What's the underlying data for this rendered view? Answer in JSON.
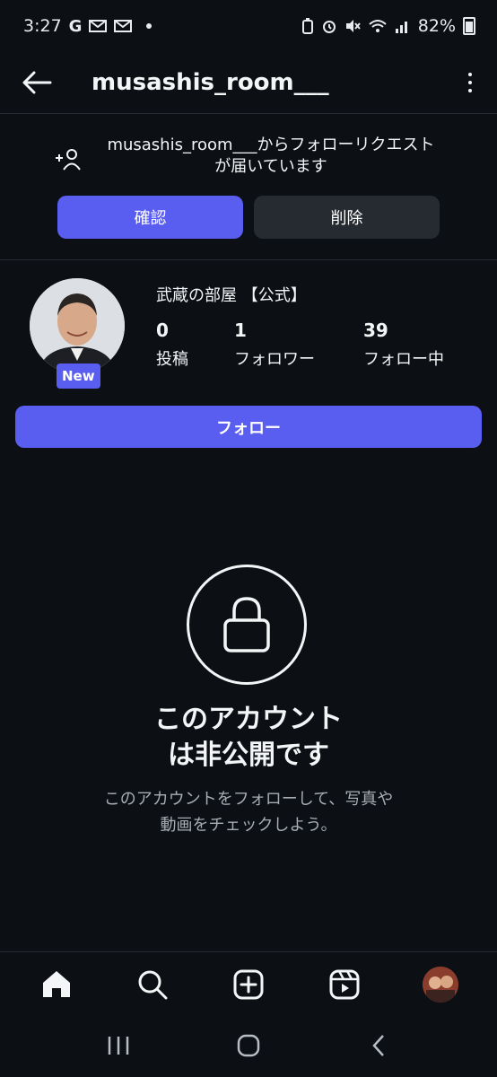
{
  "status_bar": {
    "time": "3:27",
    "app_indicator": "G",
    "battery": "82%"
  },
  "header": {
    "username": "musashis_room___"
  },
  "follow_request": {
    "line1": "musashis_room___からフォローリクエスト",
    "line2": "が届いています",
    "confirm_label": "確認",
    "delete_label": "削除"
  },
  "profile": {
    "display_name": "武蔵の部屋 【公式】",
    "new_badge": "New",
    "stats": [
      {
        "value": "0",
        "label": "投稿"
      },
      {
        "value": "1",
        "label": "フォロワー"
      },
      {
        "value": "39",
        "label": "フォロー中"
      }
    ],
    "follow_label": "フォロー"
  },
  "private_notice": {
    "title_line1": "このアカウント",
    "title_line2": "は非公開です",
    "desc_line1": "このアカウントをフォローして、写真や",
    "desc_line2": "動画をチェックしよう。"
  },
  "colors": {
    "background": "#0c0f14",
    "accent": "#5a5ef0",
    "secondary_button": "#262a31"
  },
  "icons": {
    "back": "arrow-left-icon",
    "more": "more-vertical-icon",
    "add_person": "add-person-icon",
    "lock": "lock-icon",
    "home": "home-icon",
    "search": "search-icon",
    "create": "plus-square-icon",
    "reels": "reels-icon",
    "recents": "recents-icon",
    "home_sys": "home-circle-icon",
    "back_sys": "chevron-left-icon"
  }
}
